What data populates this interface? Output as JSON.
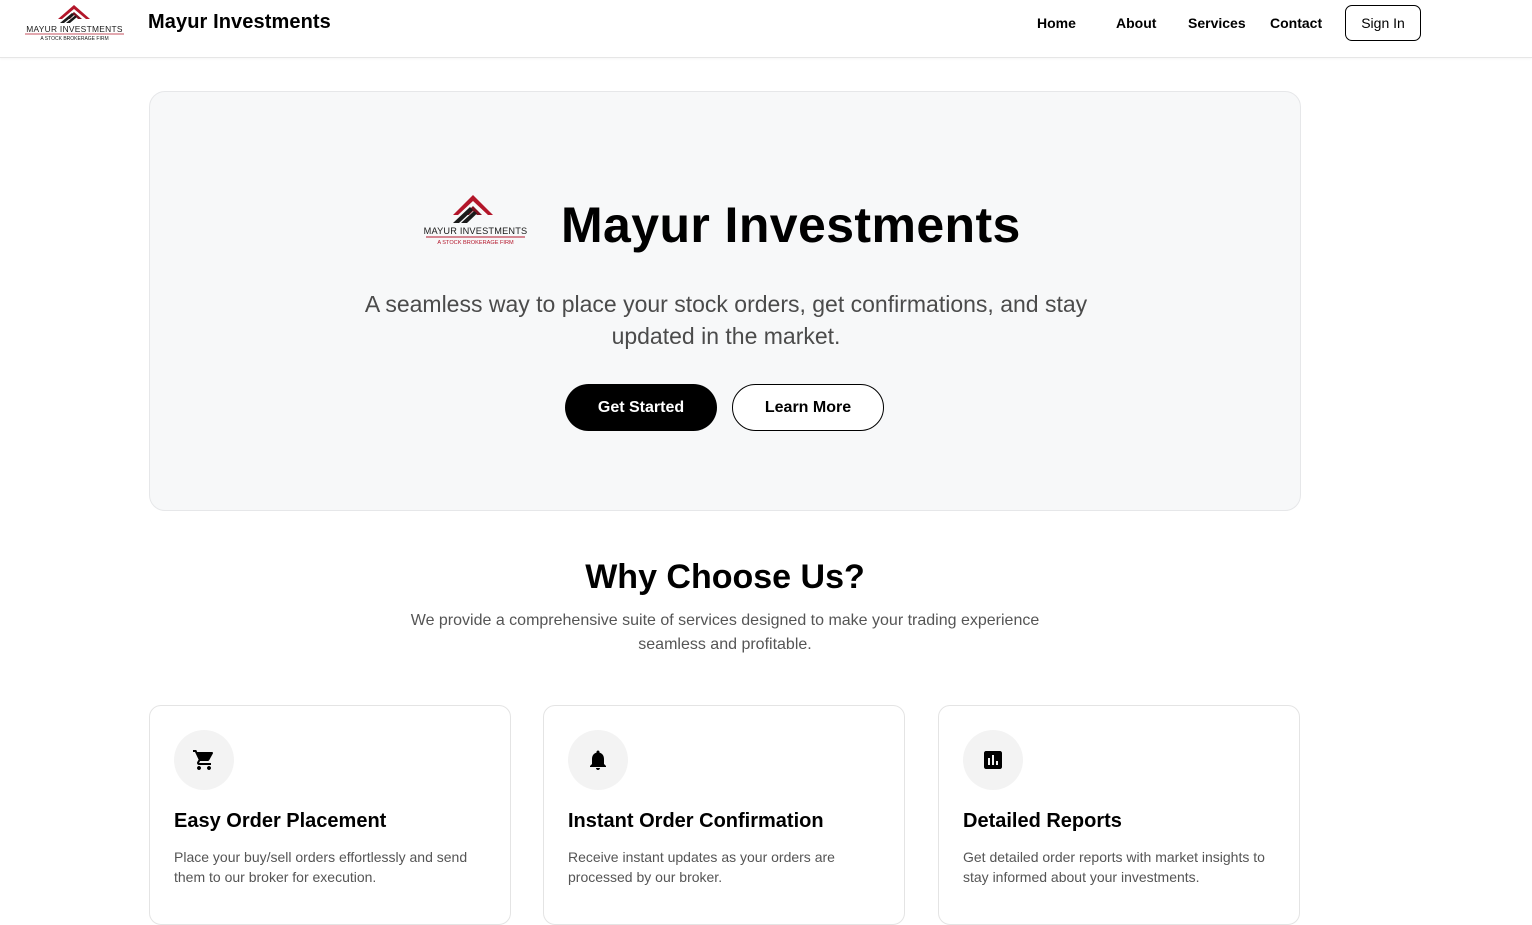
{
  "header": {
    "logo": {
      "line1": "MAYUR INVESTMENTS",
      "line2": "A STOCK BROKERAGE FIRM"
    },
    "brand": "Mayur Investments",
    "nav": {
      "home": "Home",
      "about": "About",
      "services": "Services",
      "contact": "Contact"
    },
    "sign_in": "Sign In"
  },
  "hero": {
    "title": "Mayur Investments",
    "subtitle": "A seamless way to place your stock orders, get confirmations, and stay updated in the market.",
    "get_started": "Get Started",
    "learn_more": "Learn More"
  },
  "why": {
    "title": "Why Choose Us?",
    "subtitle": "We provide a comprehensive suite of services designed to make your trading experience seamless and profitable."
  },
  "features": [
    {
      "icon": "cart-icon",
      "title": "Easy Order Placement",
      "description": "Place your buy/sell orders effortlessly and send them to our broker for execution."
    },
    {
      "icon": "bell-icon",
      "title": "Instant Order Confirmation",
      "description": "Receive instant updates as your orders are processed by our broker."
    },
    {
      "icon": "chart-icon",
      "title": "Detailed Reports",
      "description": "Get detailed order reports with market insights to stay informed about your investments."
    }
  ],
  "colors": {
    "logo_red": "#b3162a",
    "logo_dark": "#1a1a1a",
    "hero_bg": "#f7f8f9",
    "primary_button": "#000000"
  }
}
